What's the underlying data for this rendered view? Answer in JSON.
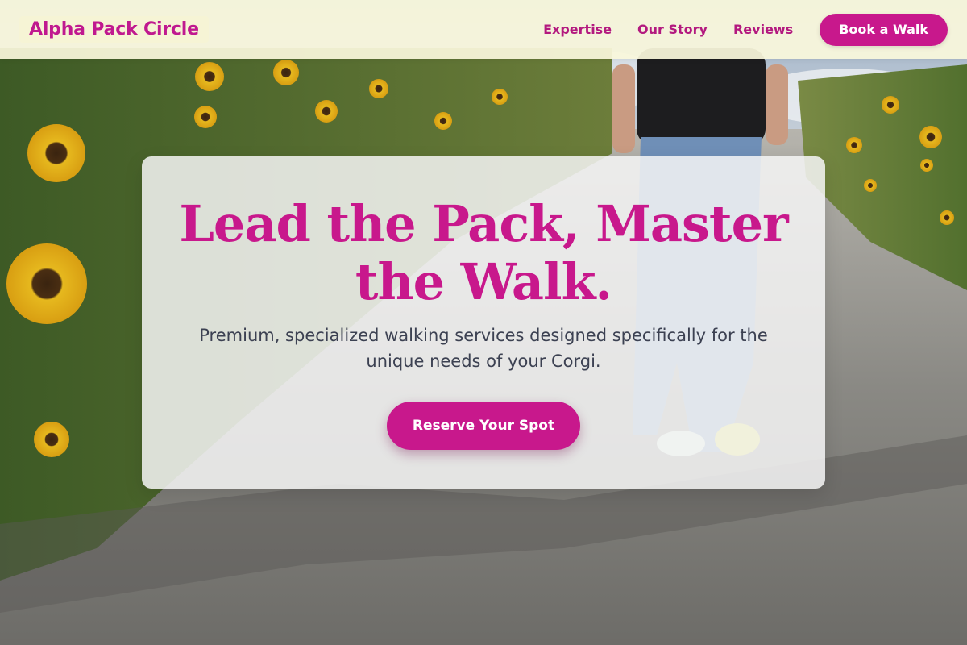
{
  "brand": {
    "name": "Alpha Pack Circle"
  },
  "nav": {
    "links": [
      {
        "label": "Expertise"
      },
      {
        "label": "Our Story"
      },
      {
        "label": "Reviews"
      }
    ],
    "cta_label": "Book a Walk"
  },
  "hero": {
    "title": "Lead the Pack, Master the Walk.",
    "subtitle": "Premium, specialized walking services designed specifically for the unique needs of your Corgi.",
    "cta_label": "Reserve Your Spot",
    "background_image": "sunflower-path-walker-photo"
  },
  "colors": {
    "accent": "#c8188c",
    "nav_background": "#faf8dc",
    "text_dark": "#3c4152",
    "card_background": "#f6f6f6"
  }
}
